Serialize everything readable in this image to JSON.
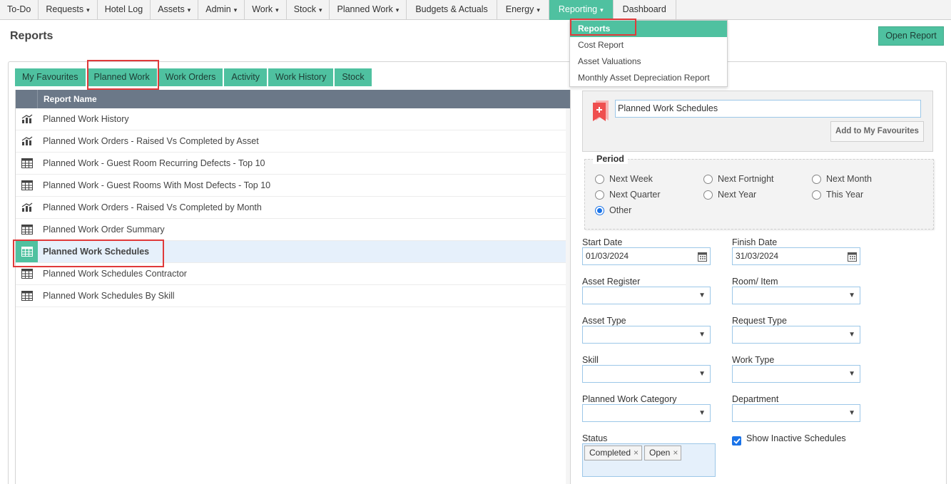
{
  "nav": {
    "items": [
      {
        "label": "To-Do"
      },
      {
        "label": "Requests",
        "caret": "▾"
      },
      {
        "label": "Hotel Log"
      },
      {
        "label": "Assets",
        "caret": "▾"
      },
      {
        "label": "Admin",
        "caret": "▾"
      },
      {
        "label": "Work",
        "caret": "▾"
      },
      {
        "label": "Stock",
        "caret": "▾"
      },
      {
        "label": "Planned Work",
        "caret": "▾"
      },
      {
        "label": "Budgets & Actuals"
      },
      {
        "label": "Energy",
        "caret": "▾"
      },
      {
        "label": "Reporting",
        "caret": "▾"
      },
      {
        "label": "Dashboard"
      }
    ],
    "dropdown": [
      {
        "label": "Reports"
      },
      {
        "label": "Cost Report"
      },
      {
        "label": "Asset Valuations"
      },
      {
        "label": "Monthly Asset Depreciation Report"
      }
    ]
  },
  "header": {
    "title": "Reports",
    "open_report": "Open Report"
  },
  "tabs": [
    "My Favourites",
    "Planned Work",
    "Work Orders",
    "Activity",
    "Work History",
    "Stock"
  ],
  "list": {
    "column_header": "Report Name",
    "rows": [
      {
        "name": "Planned Work History",
        "icon": "bar-chart-icon"
      },
      {
        "name": "Planned Work Orders - Raised Vs Completed by Asset",
        "icon": "bar-chart-icon"
      },
      {
        "name": "Planned Work - Guest Room Recurring Defects - Top 10",
        "icon": "table-icon"
      },
      {
        "name": "Planned Work - Guest Rooms With Most Defects - Top 10",
        "icon": "table-icon"
      },
      {
        "name": "Planned Work Orders - Raised Vs Completed by Month",
        "icon": "bar-chart-icon"
      },
      {
        "name": "Planned Work Order Summary",
        "icon": "table-icon"
      },
      {
        "name": "Planned Work Schedules",
        "icon": "table-icon",
        "selected": true
      },
      {
        "name": "Planned Work Schedules Contractor",
        "icon": "table-icon"
      },
      {
        "name": "Planned Work Schedules By Skill",
        "icon": "table-icon"
      }
    ]
  },
  "options": {
    "report_name": "Planned Work Schedules",
    "add_favourites": "Add to My Favourites",
    "period": {
      "legend": "Period",
      "choices": [
        "Next Week",
        "Next Fortnight",
        "Next Month",
        "Next Quarter",
        "Next Year",
        "This Year",
        "Other"
      ],
      "selected": "Other"
    },
    "start_date_label": "Start Date",
    "start_date": "01/03/2024",
    "finish_date_label": "Finish Date",
    "finish_date": "31/03/2024",
    "asset_register_label": "Asset Register",
    "room_item_label": "Room/ Item",
    "asset_type_label": "Asset Type",
    "request_type_label": "Request Type",
    "skill_label": "Skill",
    "work_type_label": "Work Type",
    "planned_work_category_label": "Planned Work Category",
    "department_label": "Department",
    "status_label": "Status",
    "status_chips": [
      "Completed",
      "Open"
    ],
    "chip_remove": "×",
    "show_inactive_label": "Show Inactive Schedules",
    "show_inactive_checked": true
  },
  "colors": {
    "accent": "#4fc1a0",
    "header_bar": "#6b7888",
    "highlight": "#e03a3a",
    "selected_row": "#e6f0fb"
  }
}
